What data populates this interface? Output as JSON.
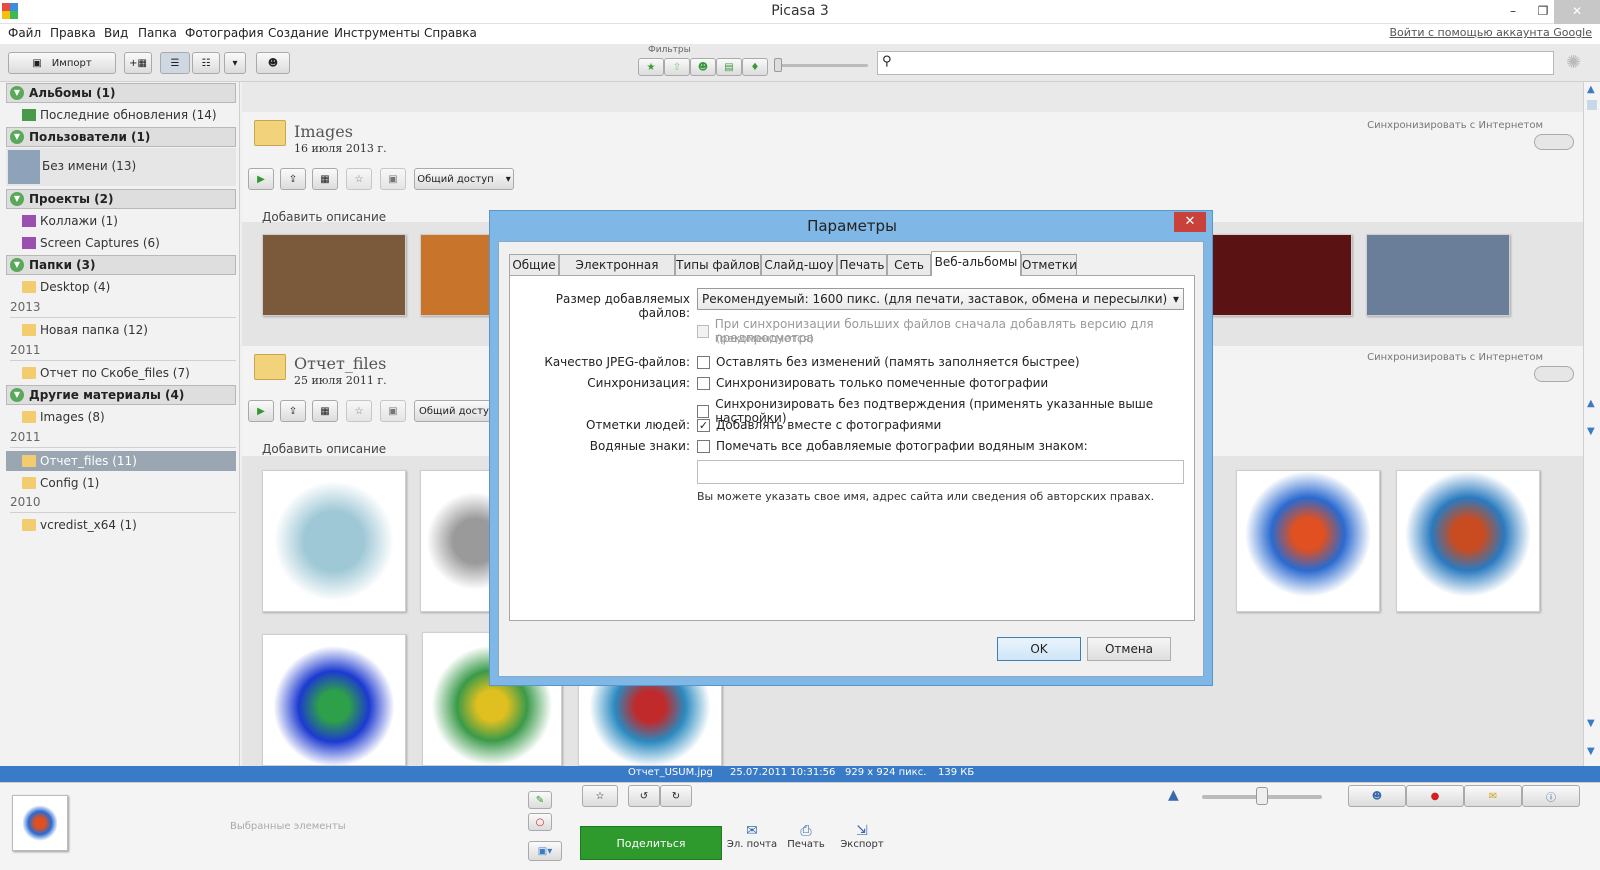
{
  "window": {
    "title": "Picasa 3",
    "min": "–",
    "restore": "❐",
    "close": "✕"
  },
  "menu": [
    "Файл",
    "Правка",
    "Вид",
    "Папка",
    "Фотография",
    "Создание",
    "Инструменты",
    "Справка"
  ],
  "google_link": "Войти с помощью аккаунта Google",
  "toolbar": {
    "import": "Импорт",
    "filters_label": "Фильтры",
    "search_value": ""
  },
  "sidebar": {
    "albums": {
      "header": "Альбомы (1)",
      "items": [
        "Последние обновления (14)"
      ]
    },
    "people": {
      "header": "Пользователи (1)",
      "items": [
        "Без имени (13)"
      ]
    },
    "projects": {
      "header": "Проекты (2)",
      "items": [
        "Коллажи (1)",
        "Screen Captures (6)"
      ]
    },
    "folders": {
      "header": "Папки (3)",
      "desktop": "Desktop (4)",
      "y2013": "2013",
      "new_folder": "Новая папка (12)",
      "y2011": "2011",
      "report": "Отчет по Скобе_files (7)"
    },
    "other": {
      "header": "Другие материалы (4)",
      "images": "Images (8)",
      "y2011": "2011",
      "selected": "Отчет_files (11)",
      "config": "Config (1)",
      "y2010": "2010",
      "vcredist": "vcredist_x64 (1)"
    }
  },
  "main": {
    "share_label": "Общий доступ",
    "sync_label": "Синхронизировать с Интернетом",
    "add_description": "Добавить описание",
    "album1": {
      "title": "Images",
      "date": "16 июля 2013 г."
    },
    "album2": {
      "title": "Отчет_files",
      "date": "25 июля 2011 г."
    }
  },
  "status": {
    "file": "Отчет_USUM.jpg",
    "date": "25.07.2011 10:31:56",
    "dims": "929 x 924 пикс.",
    "size": "139 КБ"
  },
  "bottom": {
    "selected_label": "Выбранные элементы",
    "share": "Поделиться",
    "email": "Эл. почта",
    "print": "Печать",
    "export": "Экспорт"
  },
  "dialog": {
    "title": "Параметры",
    "tabs": [
      "Общие",
      "Электронная почта",
      "Типы файлов",
      "Слайд-шоу",
      "Печать",
      "Сеть",
      "Веб-альбомы",
      "Отметки"
    ],
    "active_tab": "Веб-альбомы",
    "size_label": "Размер добавляемых файлов:",
    "size_value": "Рекомендуемый: 1600 пикс. (для печати, заставок, обмена и пересылки)",
    "preview_opt": "При синхронизации больших файлов сначала добавлять версию для предпросмотра",
    "preview_note": "(рекомендуется)",
    "jpeg_label": "Качество JPEG-файлов:",
    "jpeg_opt": "Оставлять без изменений (память заполняется быстрее)",
    "sync_label": "Синхронизация:",
    "sync_opt1": "Синхронизировать только помеченные фотографии",
    "sync_opt2": "Синхронизировать без подтверждения (применять указанные выше настройки)",
    "people_label": "Отметки людей:",
    "people_opt": "Добавлять вместе с фотографиями",
    "wm_label": "Водяные знаки:",
    "wm_opt": "Помечать все добавляемые фотографии водяным знаком:",
    "wm_value": "",
    "wm_hint": "Вы можете указать свое имя, адрес сайта или сведения об авторских правах.",
    "ok": "OK",
    "cancel": "Отмена",
    "checkmark": "✓"
  },
  "colors": {
    "accent": "#3a7bc8",
    "share_green": "#2e9a2e",
    "dialog_frame": "#7fb7e6"
  }
}
